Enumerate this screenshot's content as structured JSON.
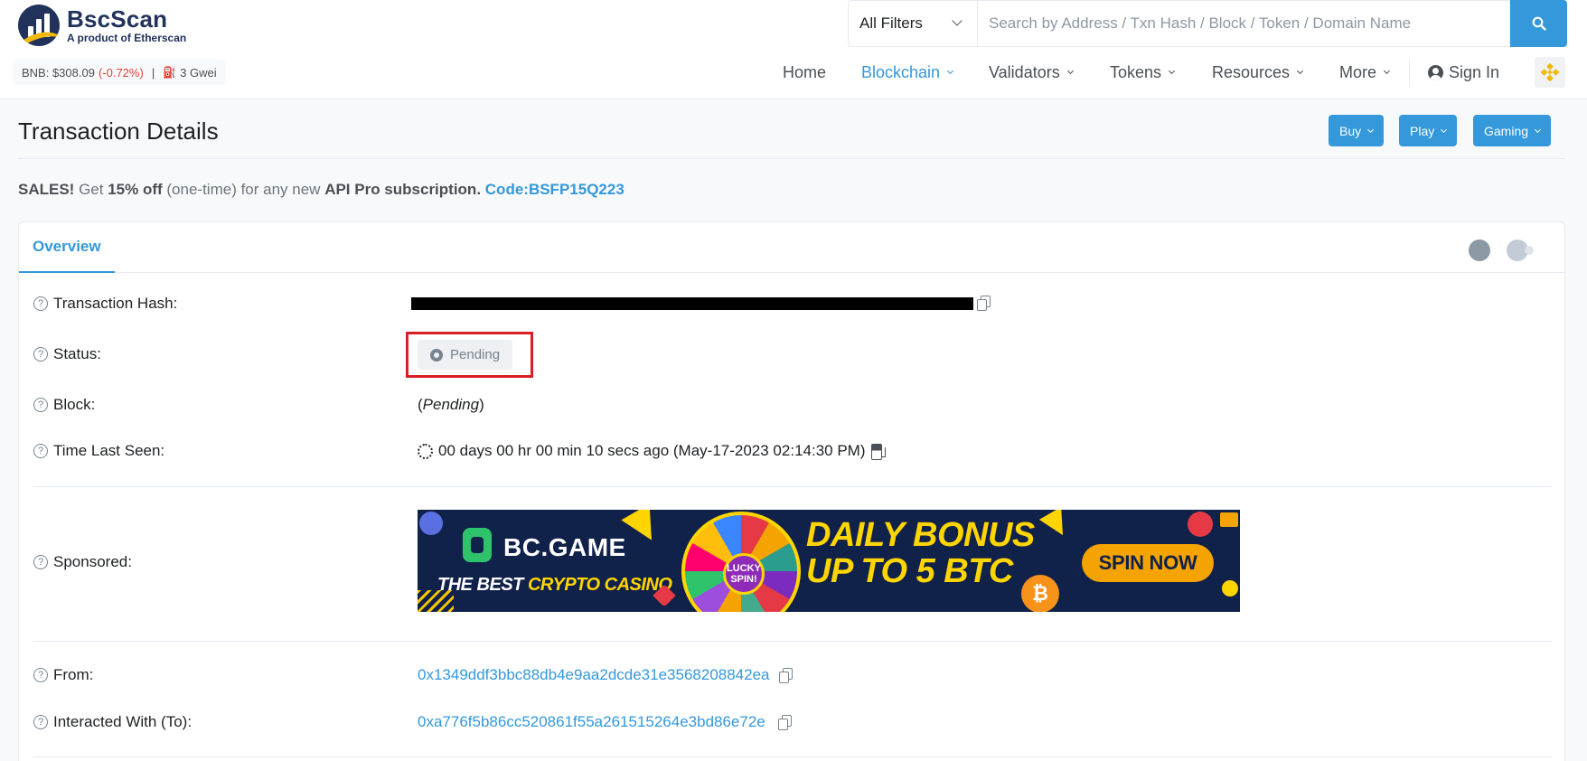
{
  "brand": {
    "name": "BscScan",
    "tagline": "A product of Etherscan"
  },
  "price_bar": {
    "label": "BNB: $308.09",
    "change": "(-0.72%)",
    "separator": "|",
    "gas": "3 Gwei"
  },
  "search": {
    "filter_value": "All Filters",
    "placeholder": "Search by Address / Txn Hash / Block / Token / Domain Name"
  },
  "nav": {
    "home": "Home",
    "blockchain": "Blockchain",
    "validators": "Validators",
    "tokens": "Tokens",
    "resources": "Resources",
    "more": "More",
    "sign_in": "Sign In"
  },
  "page": {
    "title": "Transaction Details",
    "buttons": {
      "buy": "Buy",
      "play": "Play",
      "gaming": "Gaming"
    }
  },
  "promo": {
    "sales": "SALES!",
    "get": " Get ",
    "discount": "15% off",
    "middle": " (one-time) for any new ",
    "product": "API Pro subscription.",
    "code": "Code:BSFP15Q223"
  },
  "tabs": {
    "overview": "Overview"
  },
  "details": {
    "hash_label": "Transaction Hash:",
    "status_label": "Status:",
    "status_value": "Pending",
    "block_label": "Block:",
    "block_open": "(",
    "block_value": "Pending",
    "block_close": ")",
    "time_label": "Time Last Seen:",
    "time_value": "00 days 00 hr 00 min 10 secs ago (May-17-2023 02:14:30 PM)",
    "sponsored_label": "Sponsored:",
    "from_label": "From:",
    "from_value": "0x1349ddf3bbc88db4e9aa2dcde31e3568208842ea",
    "to_label": "Interacted With (To):",
    "to_value": "0xa776f5b86cc520861f55a261515264e3bd86e72e"
  },
  "ad": {
    "brand": "BC.GAME",
    "tagline_prefix": "THE BEST ",
    "tagline_highlight": "CRYPTO CASINO",
    "hub": "LUCKY SPIN!",
    "headline_1": "DAILY BONUS",
    "headline_2": "UP TO 5 BTC",
    "cta": "SPIN NOW",
    "btc_symbol": "₿"
  },
  "colors": {
    "accent": "#3498db",
    "negative": "#de4437",
    "highlight_box": "#d81f26"
  }
}
